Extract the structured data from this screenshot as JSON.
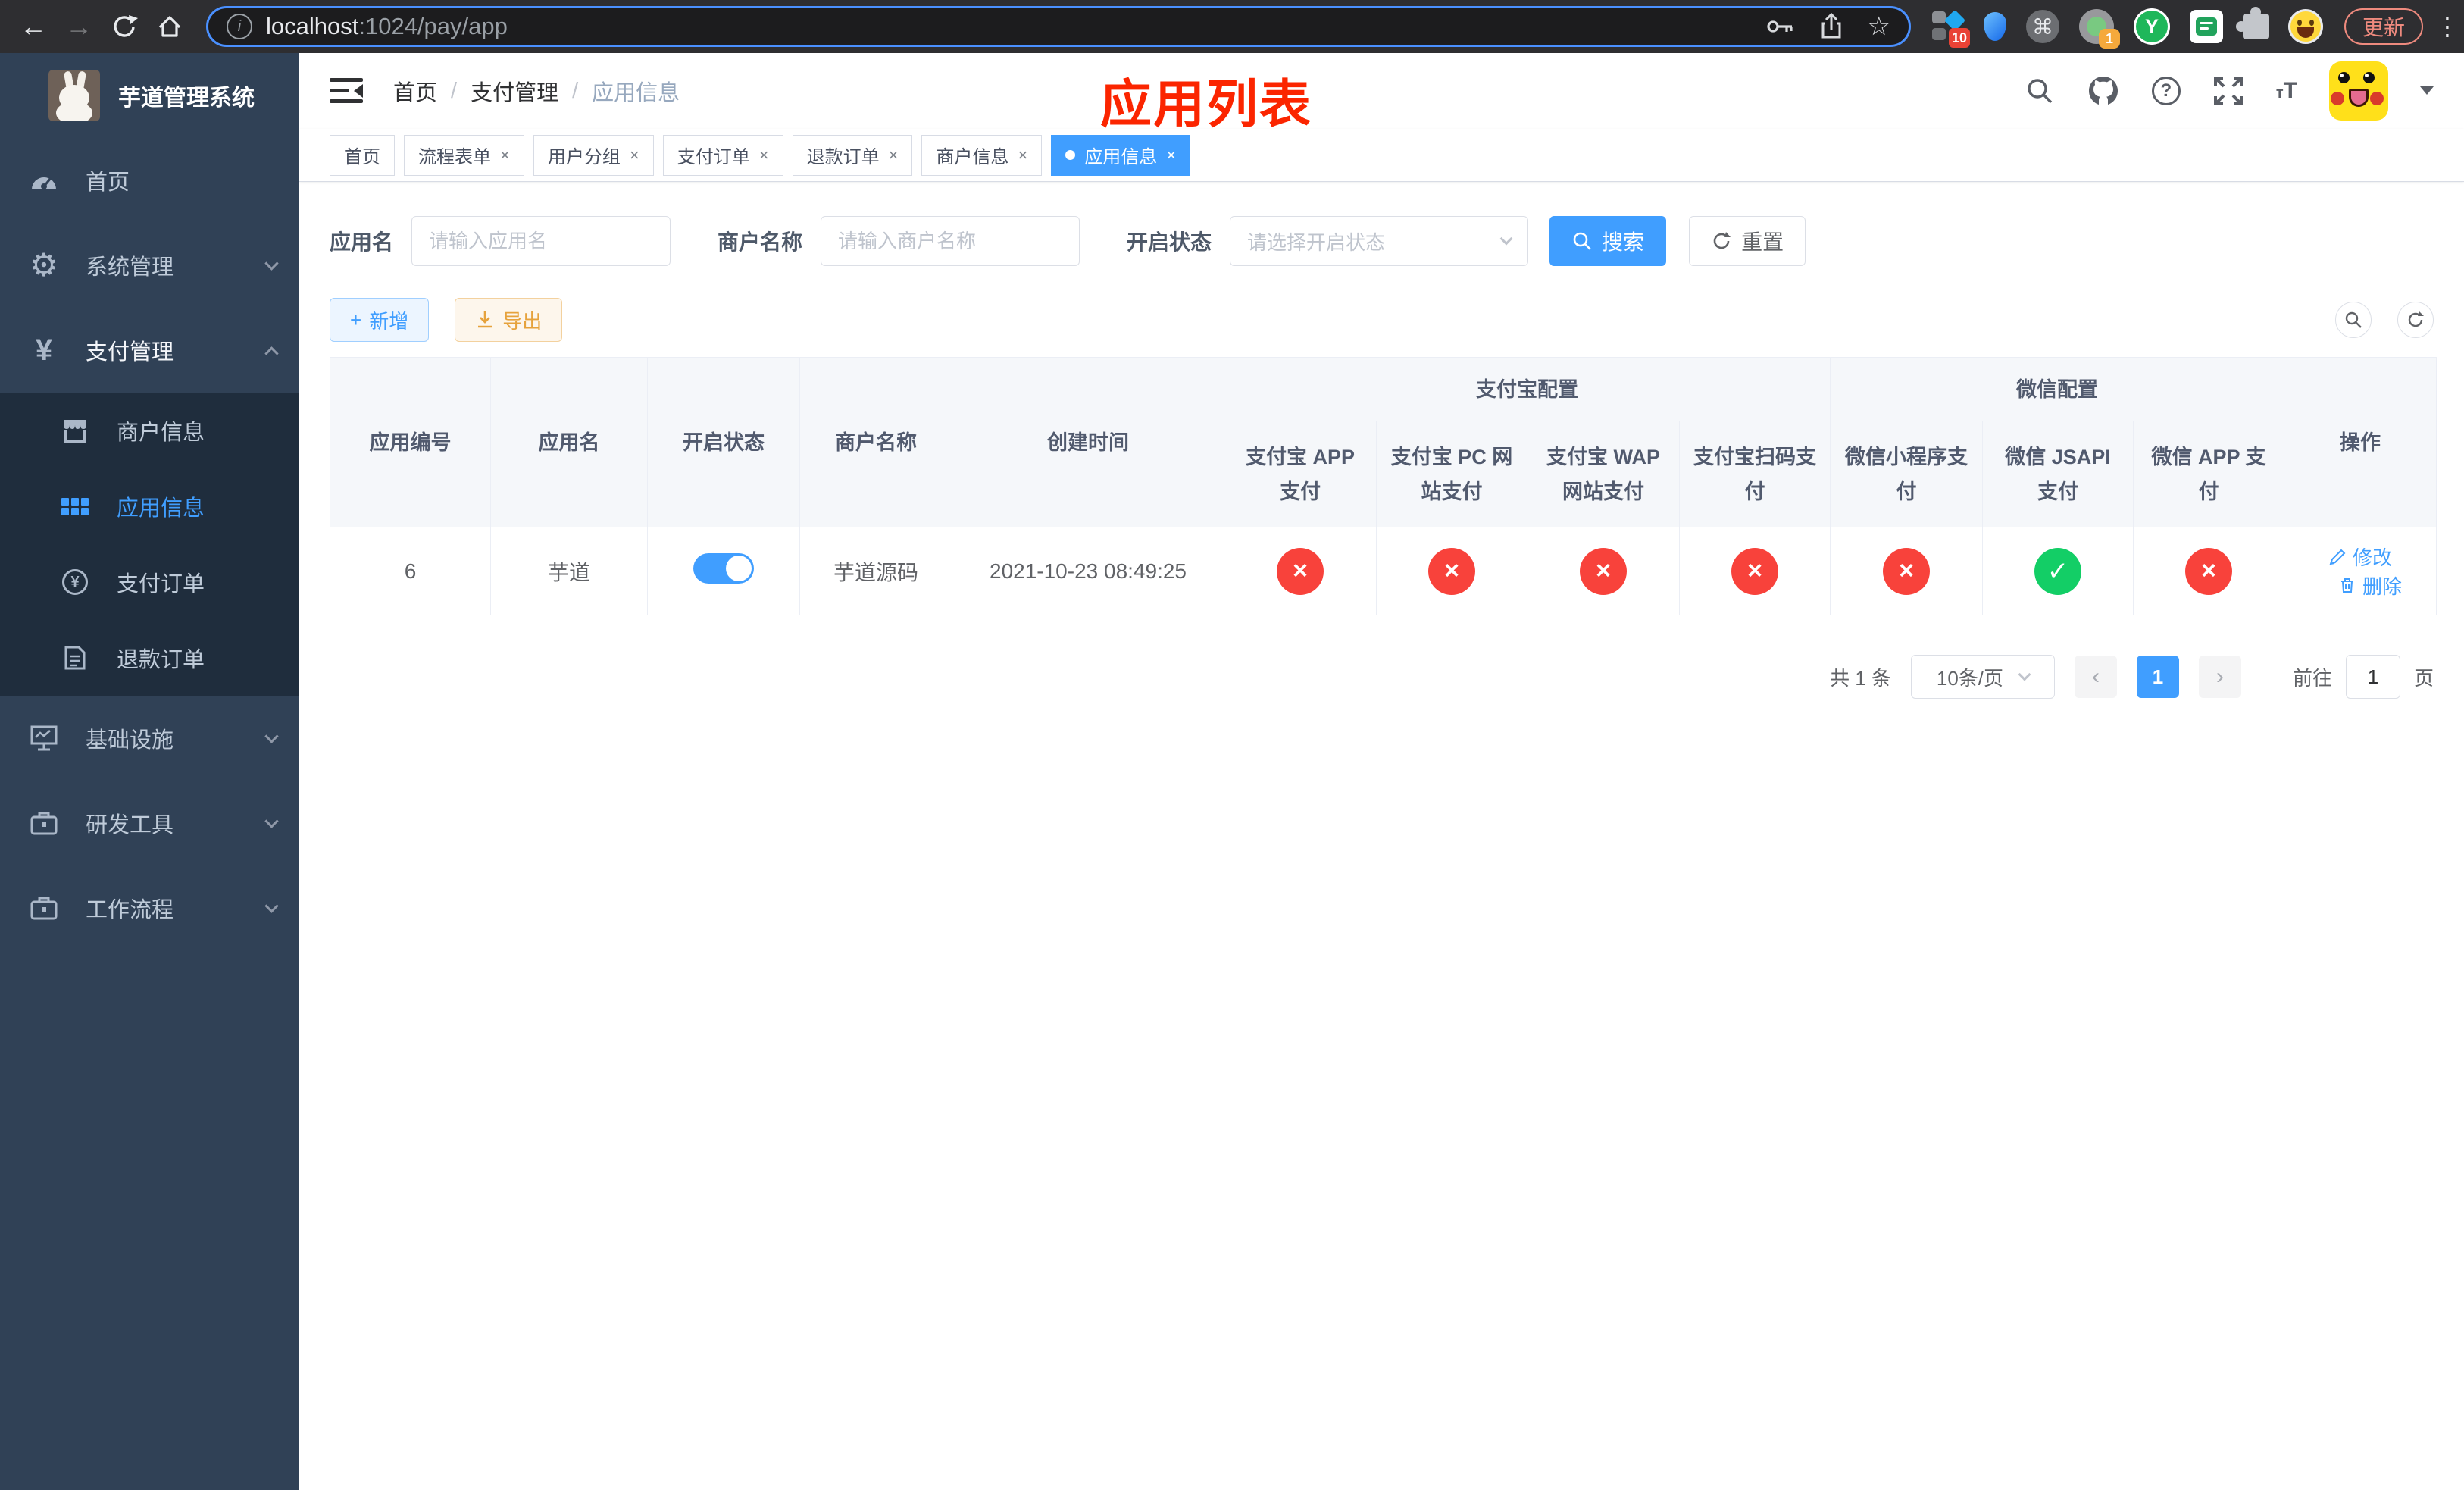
{
  "browser": {
    "url": {
      "host": "localhost",
      "path": ":1024/pay/app"
    },
    "update_label": "更新",
    "ext_badge_10": "10",
    "ext_badge_1": "1",
    "ext_y_letter": "Y",
    "command_glyph": "⌘",
    "star_glyph": "☆",
    "dots_glyph": "⋮",
    "back_glyph": "←",
    "forward_glyph": "→",
    "info_glyph": "i"
  },
  "sidebar": {
    "title": "芋道管理系统",
    "items": [
      {
        "label": "首页"
      },
      {
        "label": "系统管理"
      },
      {
        "label": "支付管理"
      },
      {
        "label": "基础设施"
      },
      {
        "label": "研发工具"
      },
      {
        "label": "工作流程"
      }
    ],
    "submenu": [
      {
        "label": "商户信息"
      },
      {
        "label": "应用信息"
      },
      {
        "label": "支付订单"
      },
      {
        "label": "退款订单"
      }
    ],
    "yen_glyph": "¥",
    "gear_glyph": "⚙"
  },
  "navbar": {
    "breadcrumb": [
      "首页",
      "支付管理",
      "应用信息"
    ],
    "separator": "/",
    "help_glyph": "?",
    "tsize_small": "т",
    "tsize_big": "T"
  },
  "overlay_title": "应用列表",
  "tabs": [
    {
      "label": "首页",
      "closable": false
    },
    {
      "label": "流程表单",
      "closable": true
    },
    {
      "label": "用户分组",
      "closable": true
    },
    {
      "label": "支付订单",
      "closable": true
    },
    {
      "label": "退款订单",
      "closable": true
    },
    {
      "label": "商户信息",
      "closable": true
    },
    {
      "label": "应用信息",
      "closable": true,
      "active": true
    }
  ],
  "tab_close_glyph": "×",
  "filters": {
    "app_name_label": "应用名",
    "app_name_placeholder": "请输入应用名",
    "merchant_label": "商户名称",
    "merchant_placeholder": "请输入商户名称",
    "status_label": "开启状态",
    "status_placeholder": "请选择开启状态",
    "search_label": "搜索",
    "reset_label": "重置"
  },
  "toolbar": {
    "add_label": "新增",
    "add_plus": "+",
    "export_label": "导出"
  },
  "table": {
    "col_headers": [
      "应用编号",
      "应用名",
      "开启状态",
      "商户名称",
      "创建时间"
    ],
    "group_alipay": "支付宝配置",
    "group_wechat": "微信配置",
    "pay_headers": [
      "支付宝 APP 支付",
      "支付宝 PC 网站支付",
      "支付宝 WAP 网站支付",
      "支付宝扫码支付",
      "微信小程序支付",
      "微信 JSAPI 支付",
      "微信 APP 支付"
    ],
    "actions_header": "操作",
    "row": {
      "id": "6",
      "name": "芋道",
      "enabled": true,
      "merchant": "芋道源码",
      "created": "2021-10-23 08:49:25",
      "statuses": [
        "fail",
        "fail",
        "fail",
        "fail",
        "fail",
        "success",
        "fail"
      ],
      "edit_label": "修改",
      "delete_label": "删除"
    },
    "glyphs": {
      "fail": "×",
      "success": "✓"
    }
  },
  "pagination": {
    "total": "共 1 条",
    "page_size": "10条/页",
    "prev_glyph": "‹",
    "next_glyph": "›",
    "current_page": "1",
    "goto_label": "前往",
    "goto_value": "1",
    "unit_label": "页"
  },
  "colors": {
    "accent": "#409eff",
    "success": "#13ce66",
    "danger": "#f8423b",
    "sidebar": "#304156"
  }
}
